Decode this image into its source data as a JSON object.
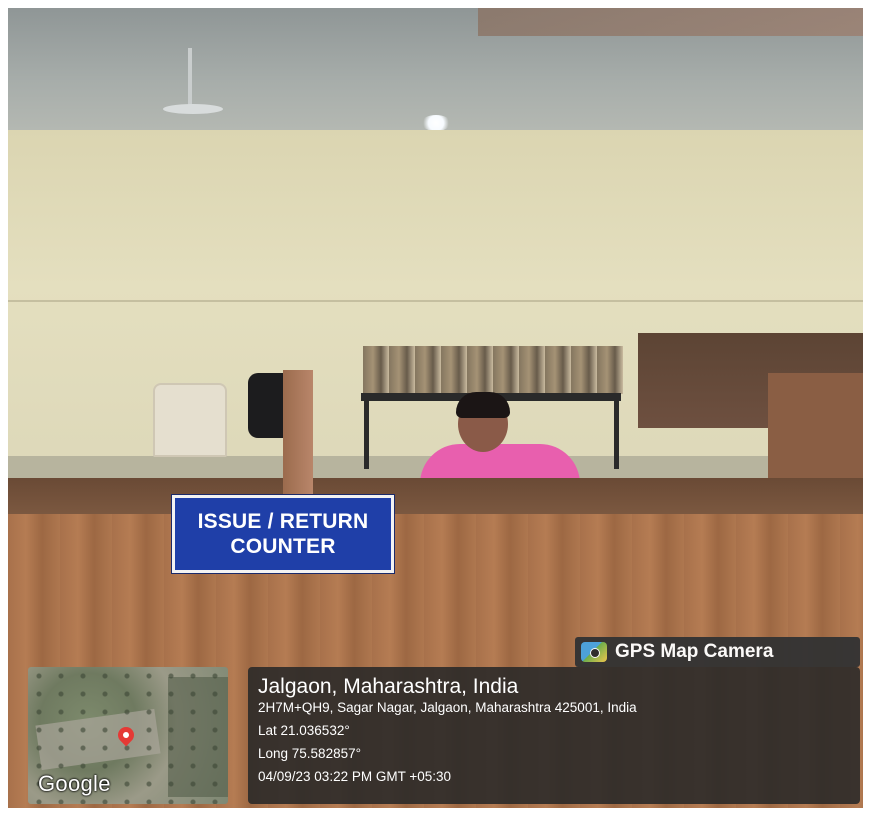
{
  "photo": {
    "sign": {
      "line1": "ISSUE / RETURN",
      "line2": "COUNTER",
      "color": "#1f3fa8"
    }
  },
  "overlay": {
    "app_badge": {
      "icon": "camera-icon",
      "label": "GPS Map Camera"
    },
    "map": {
      "logo": "Google",
      "pin_icon": "map-pin-icon"
    },
    "location": {
      "title": "Jalgaon, Maharashtra, India",
      "address": "2H7M+QH9, Sagar Nagar, Jalgaon, Maharashtra 425001, India",
      "lat": "Lat 21.036532°",
      "long": "Long 75.582857°",
      "datetime": "04/09/23 03:22 PM GMT +05:30"
    }
  }
}
